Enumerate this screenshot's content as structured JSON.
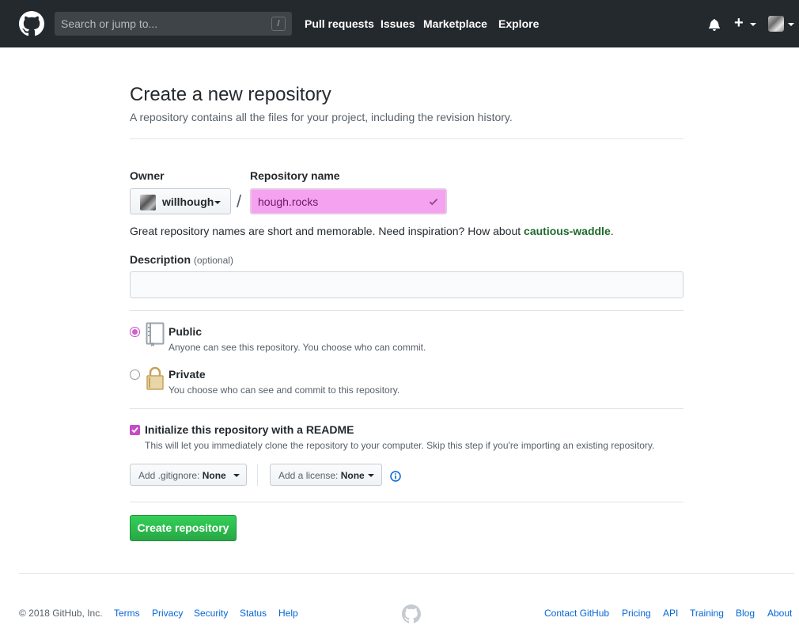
{
  "header": {
    "search_placeholder": "Search or jump to...",
    "search_key": "/",
    "nav": [
      "Pull requests",
      "Issues",
      "Marketplace",
      "Explore"
    ],
    "plus": "+"
  },
  "page": {
    "title": "Create a new repository",
    "subtitle": "A repository contains all the files for your project, including the revision history."
  },
  "form": {
    "owner_label": "Owner",
    "owner_value": "willhough",
    "separator": "/",
    "repo_label": "Repository name",
    "repo_value": "hough.rocks",
    "hint_text": "Great repository names are short and memorable. Need inspiration? How about ",
    "hint_suggestion": "cautious-waddle",
    "hint_end": ".",
    "description_label": "Description",
    "description_optional": "(optional)",
    "visibility": [
      {
        "title": "Public",
        "desc": "Anyone can see this repository. You choose who can commit.",
        "selected": true
      },
      {
        "title": "Private",
        "desc": "You choose who can see and commit to this repository.",
        "selected": false
      }
    ],
    "readme_title": "Initialize this repository with a README",
    "readme_desc": "This will let you immediately clone the repository to your computer. Skip this step if you're importing an existing repository.",
    "readme_checked": true,
    "gitignore_prefix": "Add .gitignore: ",
    "gitignore_value": "None",
    "license_prefix": "Add a license: ",
    "license_value": "None",
    "submit_label": "Create repository"
  },
  "footer": {
    "copyright": "© 2018 GitHub, Inc.",
    "left_links": [
      "Terms",
      "Privacy",
      "Security",
      "Status",
      "Help"
    ],
    "right_links": [
      "Contact GitHub",
      "Pricing",
      "API",
      "Training",
      "Blog",
      "About"
    ]
  },
  "colors": {
    "header_bg": "#24292e",
    "accent_magenta": "#d45dd1",
    "create_green": "#28a745",
    "link_blue": "#0366d6"
  }
}
